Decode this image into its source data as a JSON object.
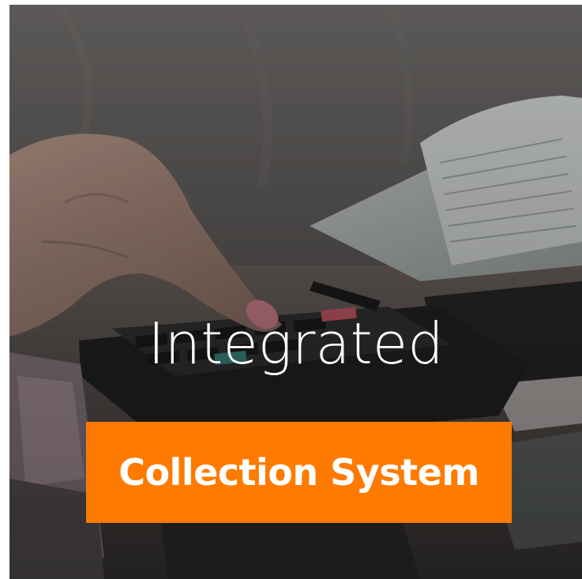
{
  "headline": {
    "text": "Integrated",
    "color": "#ffffff"
  },
  "badge": {
    "text": "Collection System",
    "background": "#ff7a00",
    "color": "#ffffff"
  },
  "photo": {
    "subject": "hand-typing-on-calculator"
  }
}
